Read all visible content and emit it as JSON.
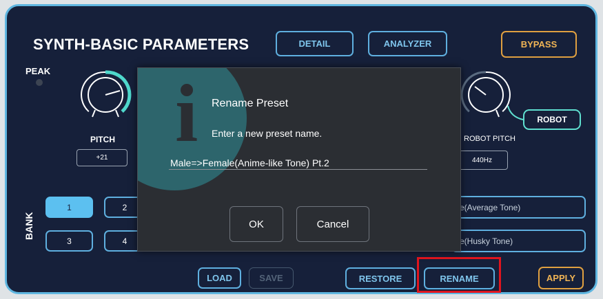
{
  "header": {
    "title": "SYNTH-BASIC PARAMETERS",
    "detail_label": "DETAIL",
    "analyzer_label": "ANALYZER",
    "bypass_label": "BYPASS"
  },
  "peak_label": "PEAK",
  "pitch": {
    "label": "PITCH",
    "value": "+21"
  },
  "robot_pitch": {
    "label": "ROBOT PITCH",
    "value": "440Hz"
  },
  "robot_button": "ROBOT",
  "bank": {
    "label": "BANK",
    "slots": [
      "1",
      "2",
      "3",
      "4"
    ],
    "active": "1"
  },
  "presets": [
    "e(Average Tone)",
    "e(Husky Tone)"
  ],
  "footer": {
    "load": "LOAD",
    "save": "SAVE",
    "restore": "RESTORE",
    "rename": "RENAME",
    "apply": "APPLY"
  },
  "dialog": {
    "icon": "info-icon",
    "title": "Rename Preset",
    "message": "Enter a new preset name.",
    "input_value": "Male=>Female(Anime-like Tone) Pt.2",
    "ok": "OK",
    "cancel": "Cancel"
  },
  "colors": {
    "panel_bg": "#16203a",
    "frame": "#5fb6e0",
    "accent_blue": "#5fb0e0",
    "accent_orange": "#e0a040",
    "accent_teal": "#5fe0d0",
    "highlight_red": "#e0151e",
    "dialog_bg": "#2b2e33"
  }
}
